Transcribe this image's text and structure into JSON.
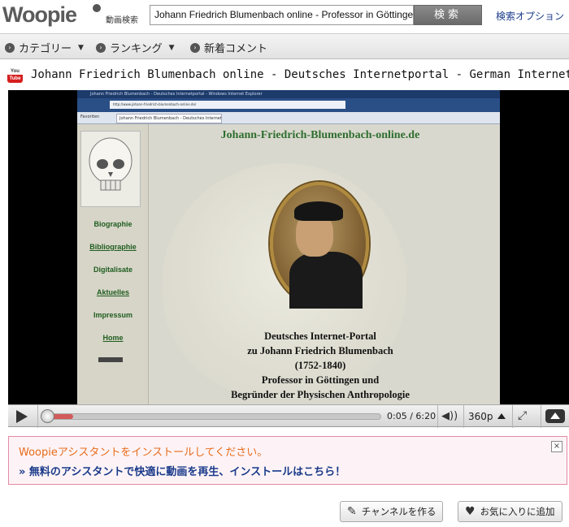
{
  "header": {
    "logo": "Woopie",
    "logo_sub": "動画検索",
    "search_value": "Johann Friedrich Blumenbach online - Professor in Göttingen",
    "search_button": "検索",
    "search_options": "検索オプション"
  },
  "nav": {
    "items": [
      {
        "label": "カテゴリー",
        "has_caret": true
      },
      {
        "label": "ランキング",
        "has_caret": true
      },
      {
        "label": "新着コメント",
        "has_caret": false
      }
    ]
  },
  "video": {
    "source_icon": "youtube-icon",
    "source_icon_text_top": "You",
    "source_icon_text_bottom": "Tube",
    "title": "Johann Friedrich Blumenbach online - Deutsches Internetportal - German Internet",
    "frame": {
      "browser_title": "Johann Friedrich Blumenbach - Deutsches Internetportal - Windows Internet Explorer",
      "address": "http://www.johann-friedrich-blumenbach-online.de/",
      "favorites": "Favoriten",
      "tab_label": "Johann Friedrich Blumenbach - Deutsches Internetportal",
      "site_title": "Johann-Friedrich-Blumenbach-online.de",
      "side_links": [
        "Biographie",
        "Bibliographie",
        "Digitalisate",
        "Aktuelles",
        "Impressum",
        "Home"
      ],
      "portal_lines": [
        "Deutsches Internet-Portal",
        "zu Johann Friedrich Blumenbach",
        "(1752-1840)",
        "Professor in Göttingen und",
        "Begründer der Physischen Anthropologie"
      ]
    },
    "controls": {
      "time": "0:05 / 6:20",
      "quality": "360p",
      "progress_fraction": 0.013
    }
  },
  "banner": {
    "title": "Woopieアシスタントをインストールしてください。",
    "link": "» 無料のアシスタントで快適に動画を再生、インストールはこちら！",
    "close": "×"
  },
  "actions": {
    "create_channel": "チャンネルを作る",
    "add_favorite": "お気に入りに追加"
  }
}
